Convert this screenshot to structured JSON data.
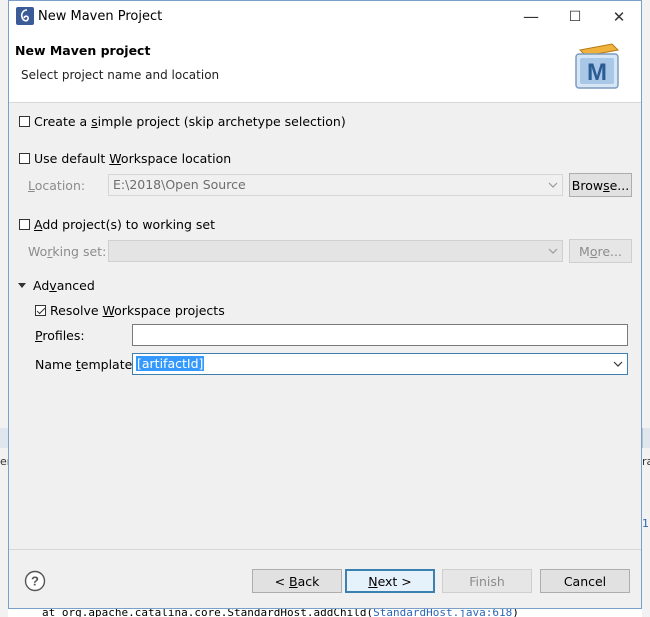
{
  "window": {
    "title": "New Maven Project",
    "minimize_glyph": "—",
    "maximize_glyph": "☐",
    "close_glyph": "✕"
  },
  "banner": {
    "title": "New Maven project",
    "subtitle": "Select project name and location",
    "logo_letter": "M"
  },
  "options": {
    "simple_project": {
      "label_pre": "Create a ",
      "label_u": "s",
      "label_post": "imple project (skip archetype selection)",
      "checked": false
    },
    "default_workspace": {
      "label_pre": "Use default ",
      "label_u": "W",
      "label_post": "orkspace location",
      "checked": false
    },
    "location": {
      "label_u": "L",
      "label_post": "ocation:",
      "value": "E:\\2018\\Open Source",
      "browse_pre": "Brow",
      "browse_u": "s",
      "browse_post": "e..."
    },
    "working_set_check": {
      "label_pre": "",
      "label_u": "A",
      "label_post": "dd project(s) to working set",
      "checked": false
    },
    "working_set": {
      "label_pre": "Wo",
      "label_u": "r",
      "label_post": "king set:",
      "value": "",
      "more_pre": "M",
      "more_u": "o",
      "more_post": "re..."
    }
  },
  "advanced": {
    "toggle_label_pre": "Ad",
    "toggle_label_u": "v",
    "toggle_label_post": "anced",
    "resolve": {
      "label_pre": "Resolve ",
      "label_u": "W",
      "label_post": "orkspace projects",
      "checked": true
    },
    "profiles": {
      "label_u": "P",
      "label_post": "rofiles:",
      "value": ""
    },
    "name_template": {
      "label_pre": "Name ",
      "label_u": "t",
      "label_post": "emplate:",
      "value": "[artifactId]"
    }
  },
  "footer": {
    "back": {
      "pre": "< ",
      "u": "B",
      "post": "ack"
    },
    "next": {
      "pre": "",
      "u": "N",
      "post": "ext >"
    },
    "finish": "Finish",
    "cancel": "Cancel"
  },
  "background": {
    "console_line_pre": "at org.apache.catalina.core.StandardHost.addChild(",
    "console_link": "StandardHost.java:618",
    "console_line_post": ")",
    "edge_left": "er",
    "edge_right": "ra",
    "edge_right2": "1"
  }
}
